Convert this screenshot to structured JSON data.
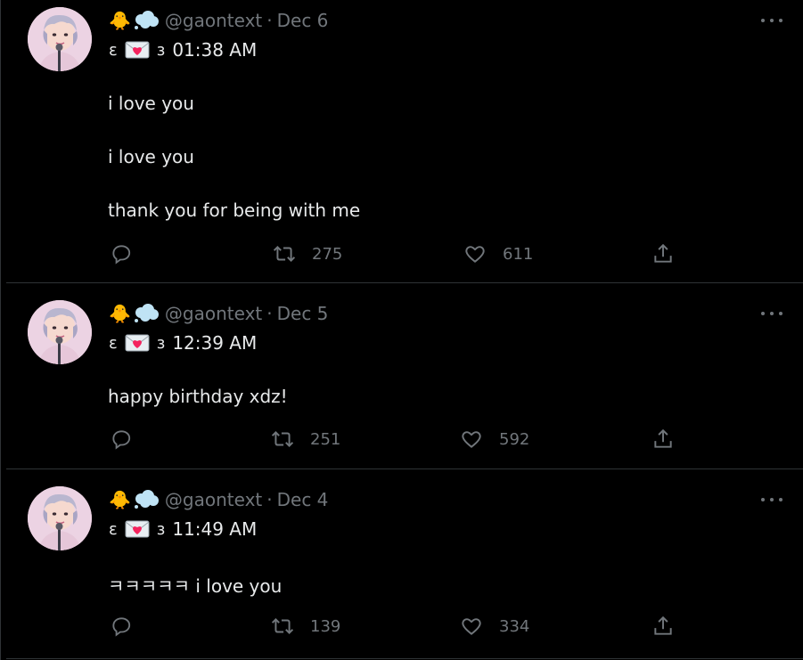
{
  "colors": {
    "background": "#000000",
    "text": "#e7e9ea",
    "secondary": "#71767b",
    "divider": "#2f3336",
    "envelope_heart": "#f4245e",
    "chick": "#ffcc4d",
    "cloud": "#bfe3f5"
  },
  "tweets": [
    {
      "emoji": "🐥",
      "handle": "@gaontext",
      "separator": "·",
      "date": "Dec 6",
      "bracket_open": "ɛ",
      "bracket_close": "з",
      "time": "01:38 AM",
      "lines": [
        "i love you",
        "i love you",
        "thank you for being with me"
      ],
      "actions": {
        "reply": "",
        "retweet": "275",
        "like": "611",
        "share": ""
      }
    },
    {
      "emoji": "🐥",
      "handle": "@gaontext",
      "separator": "·",
      "date": "Dec 5",
      "bracket_open": "ɛ",
      "bracket_close": "з",
      "time": "12:39 AM",
      "lines": [
        "happy birthday xdz!"
      ],
      "actions": {
        "reply": "",
        "retweet": "251",
        "like": "592",
        "share": ""
      }
    },
    {
      "emoji": "🐥",
      "handle": "@gaontext",
      "separator": "·",
      "date": "Dec 4",
      "bracket_open": "ɛ",
      "bracket_close": "з",
      "time": "11:49 AM",
      "lines": [
        "ㅋㅋㅋㅋㅋ i love you"
      ],
      "actions": {
        "reply": "",
        "retweet": "139",
        "like": "334",
        "share": ""
      }
    }
  ]
}
